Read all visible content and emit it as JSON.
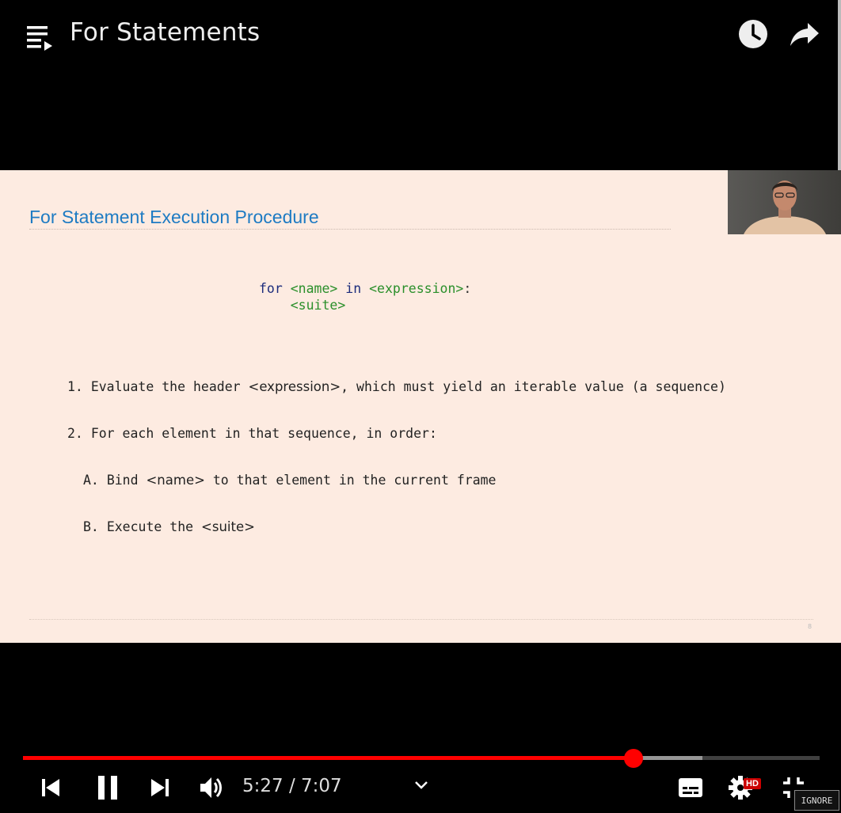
{
  "video": {
    "title": "For Statements"
  },
  "slide": {
    "title": "For Statement Execution Procedure",
    "code": {
      "kw_for": "for",
      "name": "<name>",
      "kw_in": "in",
      "expression": "<expression>",
      "colon": ":",
      "suite": "<suite>"
    },
    "steps": [
      {
        "marker": "1.",
        "pre": "Evaluate the header ",
        "code": "<expression>",
        "post": ", which must yield an iterable value (a sequence)"
      },
      {
        "marker": "2.",
        "pre": "For each element in that sequence, in order:",
        "code": "",
        "post": ""
      },
      {
        "marker": "A.",
        "pre": "Bind ",
        "code": "<name>",
        "post": " to that element in the current frame"
      },
      {
        "marker": "B.",
        "pre": "Execute the ",
        "code": "<suite>",
        "post": ""
      }
    ],
    "page_number": "8"
  },
  "player": {
    "current_time": "5:27",
    "duration": "7:07",
    "time_display": "5:27 / 7:07",
    "played_fraction": 0.766,
    "buffered_fraction": 0.853,
    "hd_badge": "HD",
    "accent_color": "#ff0000"
  },
  "overlay": {
    "ignore_label": "IGNORE"
  },
  "icons": [
    "playlist-icon",
    "clock-icon",
    "share-icon",
    "skip-previous-icon",
    "pause-icon",
    "skip-next-icon",
    "volume-icon",
    "chevron-down-icon",
    "subtitles-icon",
    "gear-icon",
    "exit-fullscreen-icon"
  ]
}
